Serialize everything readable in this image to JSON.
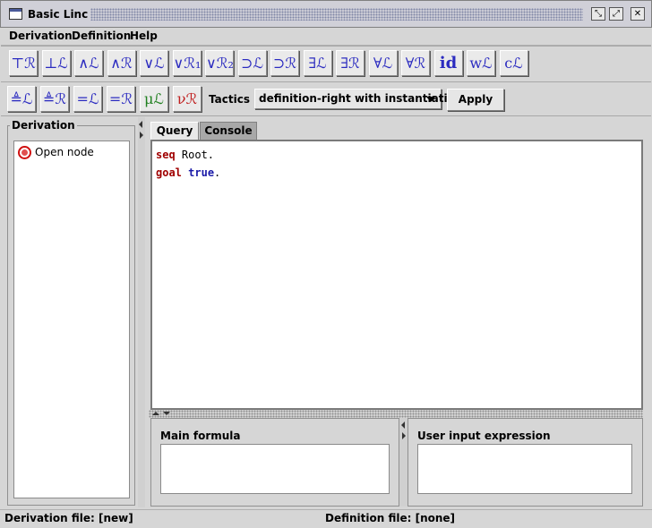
{
  "window": {
    "title": "Basic Linc"
  },
  "menu": [
    {
      "label": "Derivation"
    },
    {
      "label": "Definition"
    },
    {
      "label": "Help"
    }
  ],
  "rule_buttons_row1": [
    {
      "label": "⊤ℛ",
      "icon": "top-right-icon"
    },
    {
      "label": "⊥ℒ",
      "icon": "bottom-left-icon"
    },
    {
      "label": "∧ℒ",
      "icon": "and-left-icon"
    },
    {
      "label": "∧ℛ",
      "icon": "and-right-icon"
    },
    {
      "label": "∨ℒ",
      "icon": "or-left-icon"
    },
    {
      "label": "∨ℛ₁",
      "icon": "or-right1-icon"
    },
    {
      "label": "∨ℛ₂",
      "icon": "or-right2-icon"
    },
    {
      "label": "⊃ℒ",
      "icon": "implies-left-icon"
    },
    {
      "label": "⊃ℛ",
      "icon": "implies-right-icon"
    },
    {
      "label": "∃ℒ",
      "icon": "exists-left-icon"
    },
    {
      "label": "∃ℛ",
      "icon": "exists-right-icon"
    },
    {
      "label": "∀ℒ",
      "icon": "forall-left-icon"
    },
    {
      "label": "∀ℛ",
      "icon": "forall-right-icon"
    },
    {
      "label": "id",
      "icon": "identity-icon"
    },
    {
      "label": "wℒ",
      "icon": "weaken-left-icon"
    },
    {
      "label": "cℒ",
      "icon": "contract-left-icon"
    }
  ],
  "rule_buttons_row2": [
    {
      "label": "≜ℒ",
      "icon": "defeq-left-icon"
    },
    {
      "label": "≜ℛ",
      "icon": "defeq-right-icon"
    },
    {
      "label": "=ℒ",
      "icon": "eq-left-icon"
    },
    {
      "label": "=ℛ",
      "icon": "eq-right-icon"
    },
    {
      "label": "μℒ",
      "icon": "mu-left-icon"
    },
    {
      "label": "νℛ",
      "icon": "nu-right-icon"
    }
  ],
  "tactics": {
    "label": "Tactics",
    "selected": "definition-right with instantiation",
    "apply_label": "Apply"
  },
  "left_panel": {
    "title": "Derivation",
    "tree_items": [
      {
        "label": "Open node"
      }
    ]
  },
  "tabs": [
    {
      "label": "Query",
      "active": true
    },
    {
      "label": "Console",
      "active": false
    }
  ],
  "editor": {
    "lines": [
      {
        "keyword": "seq",
        "rest": " Root."
      },
      {
        "keyword": "goal",
        "value": "true",
        "rest": "."
      }
    ]
  },
  "main_formula": {
    "label": "Main formula"
  },
  "user_input": {
    "label": "User input expression"
  },
  "status": {
    "derivation_file": "Derivation file: [new]",
    "definition_file": "Definition file: [none]"
  },
  "colors": {
    "rule_blue": "#2b2bc0",
    "keyword_red": "#a00000",
    "keyword_blue": "#1a1aa8",
    "node_red": "#d01010"
  }
}
